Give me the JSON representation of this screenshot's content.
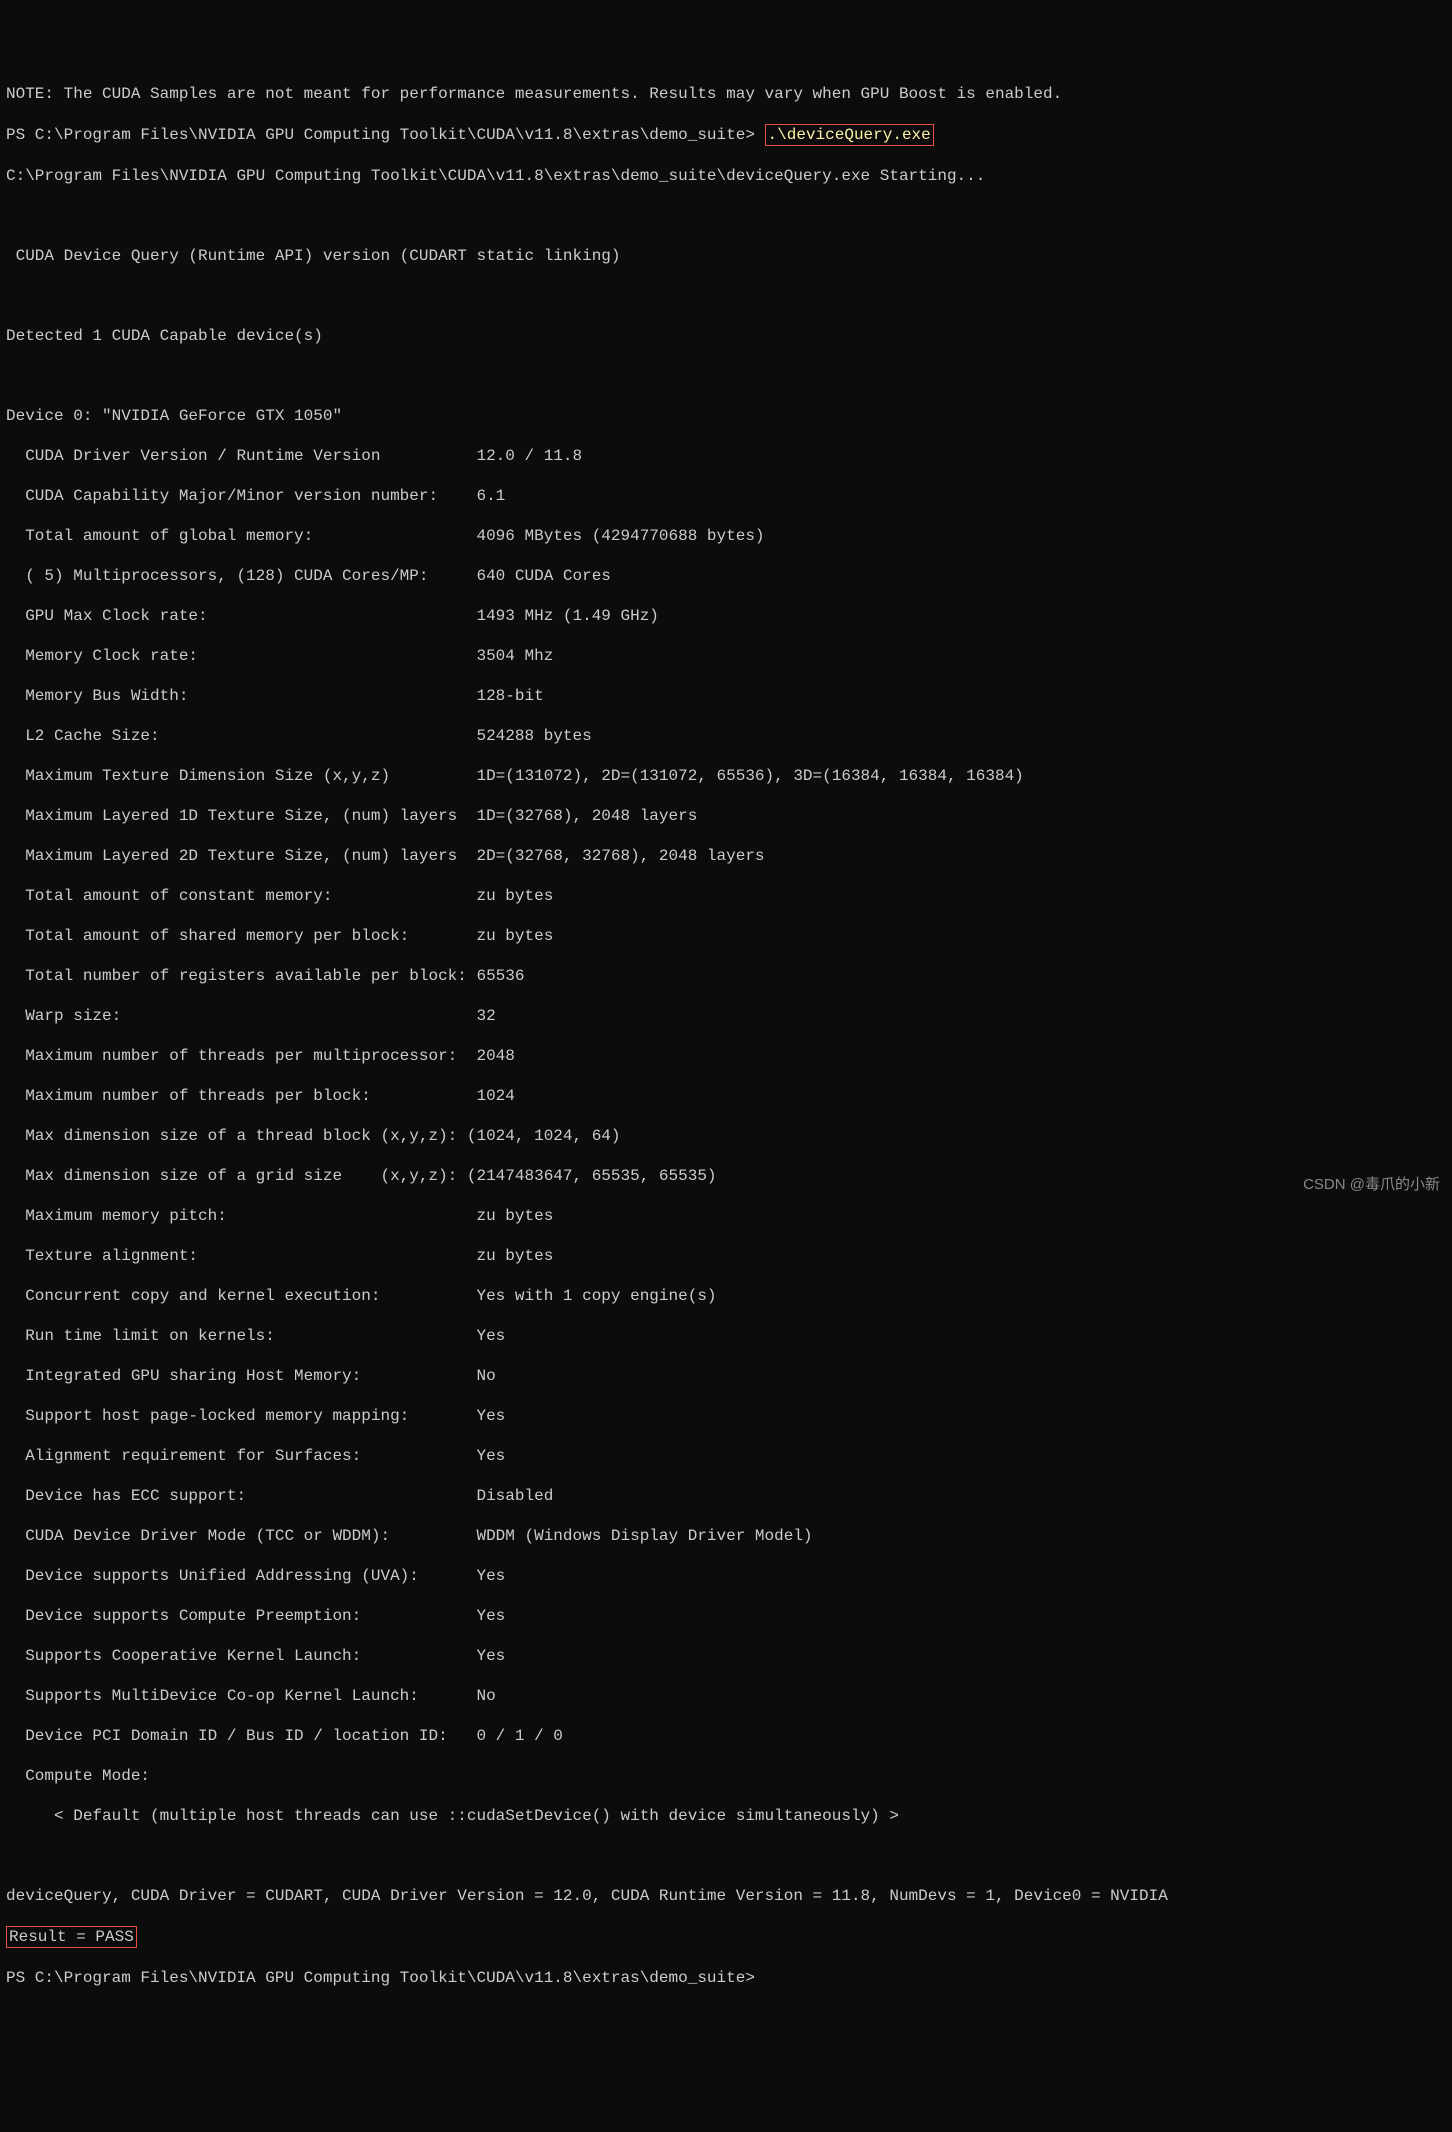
{
  "lines": {
    "note": "NOTE: The CUDA Samples are not meant for performance measurements. Results may vary when GPU Boost is enabled.",
    "prompt1_prefix": "PS C:\\Program Files\\NVIDIA GPU Computing Toolkit\\CUDA\\v11.8\\extras\\demo_suite> ",
    "command": ".\\deviceQuery.exe",
    "starting": "C:\\Program Files\\NVIDIA GPU Computing Toolkit\\CUDA\\v11.8\\extras\\demo_suite\\deviceQuery.exe Starting...",
    "header": " CUDA Device Query (Runtime API) version (CUDART static linking)",
    "detected": "Detected 1 CUDA Capable device(s)",
    "device": "Device 0: \"NVIDIA GeForce GTX 1050\"",
    "p1": "  CUDA Driver Version / Runtime Version          12.0 / 11.8",
    "p2": "  CUDA Capability Major/Minor version number:    6.1",
    "p3": "  Total amount of global memory:                 4096 MBytes (4294770688 bytes)",
    "p4": "  ( 5) Multiprocessors, (128) CUDA Cores/MP:     640 CUDA Cores",
    "p5": "  GPU Max Clock rate:                            1493 MHz (1.49 GHz)",
    "p6": "  Memory Clock rate:                             3504 Mhz",
    "p7": "  Memory Bus Width:                              128-bit",
    "p8": "  L2 Cache Size:                                 524288 bytes",
    "p9": "  Maximum Texture Dimension Size (x,y,z)         1D=(131072), 2D=(131072, 65536), 3D=(16384, 16384, 16384)",
    "p10": "  Maximum Layered 1D Texture Size, (num) layers  1D=(32768), 2048 layers",
    "p11": "  Maximum Layered 2D Texture Size, (num) layers  2D=(32768, 32768), 2048 layers",
    "p12": "  Total amount of constant memory:               zu bytes",
    "p13": "  Total amount of shared memory per block:       zu bytes",
    "p14": "  Total number of registers available per block: 65536",
    "p15": "  Warp size:                                     32",
    "p16": "  Maximum number of threads per multiprocessor:  2048",
    "p17": "  Maximum number of threads per block:           1024",
    "p18": "  Max dimension size of a thread block (x,y,z): (1024, 1024, 64)",
    "p19": "  Max dimension size of a grid size    (x,y,z): (2147483647, 65535, 65535)",
    "p20": "  Maximum memory pitch:                          zu bytes",
    "p21": "  Texture alignment:                             zu bytes",
    "p22": "  Concurrent copy and kernel execution:          Yes with 1 copy engine(s)",
    "p23": "  Run time limit on kernels:                     Yes",
    "p24": "  Integrated GPU sharing Host Memory:            No",
    "p25": "  Support host page-locked memory mapping:       Yes",
    "p26": "  Alignment requirement for Surfaces:            Yes",
    "p27": "  Device has ECC support:                        Disabled",
    "p28": "  CUDA Device Driver Mode (TCC or WDDM):         WDDM (Windows Display Driver Model)",
    "p29": "  Device supports Unified Addressing (UVA):      Yes",
    "p30": "  Device supports Compute Preemption:            Yes",
    "p31": "  Supports Cooperative Kernel Launch:            Yes",
    "p32": "  Supports MultiDevice Co-op Kernel Launch:      No",
    "p33": "  Device PCI Domain ID / Bus ID / location ID:   0 / 1 / 0",
    "p34": "  Compute Mode:",
    "p35": "     < Default (multiple host threads can use ::cudaSetDevice() with device simultaneously) >",
    "summary": "deviceQuery, CUDA Driver = CUDART, CUDA Driver Version = 12.0, CUDA Runtime Version = 11.8, NumDevs = 1, Device0 = NVIDIA",
    "result": "Result = PASS",
    "prompt2": "PS C:\\Program Files\\NVIDIA GPU Computing Toolkit\\CUDA\\v11.8\\extras\\demo_suite>"
  },
  "watermark": "CSDN @毒爪的小新"
}
